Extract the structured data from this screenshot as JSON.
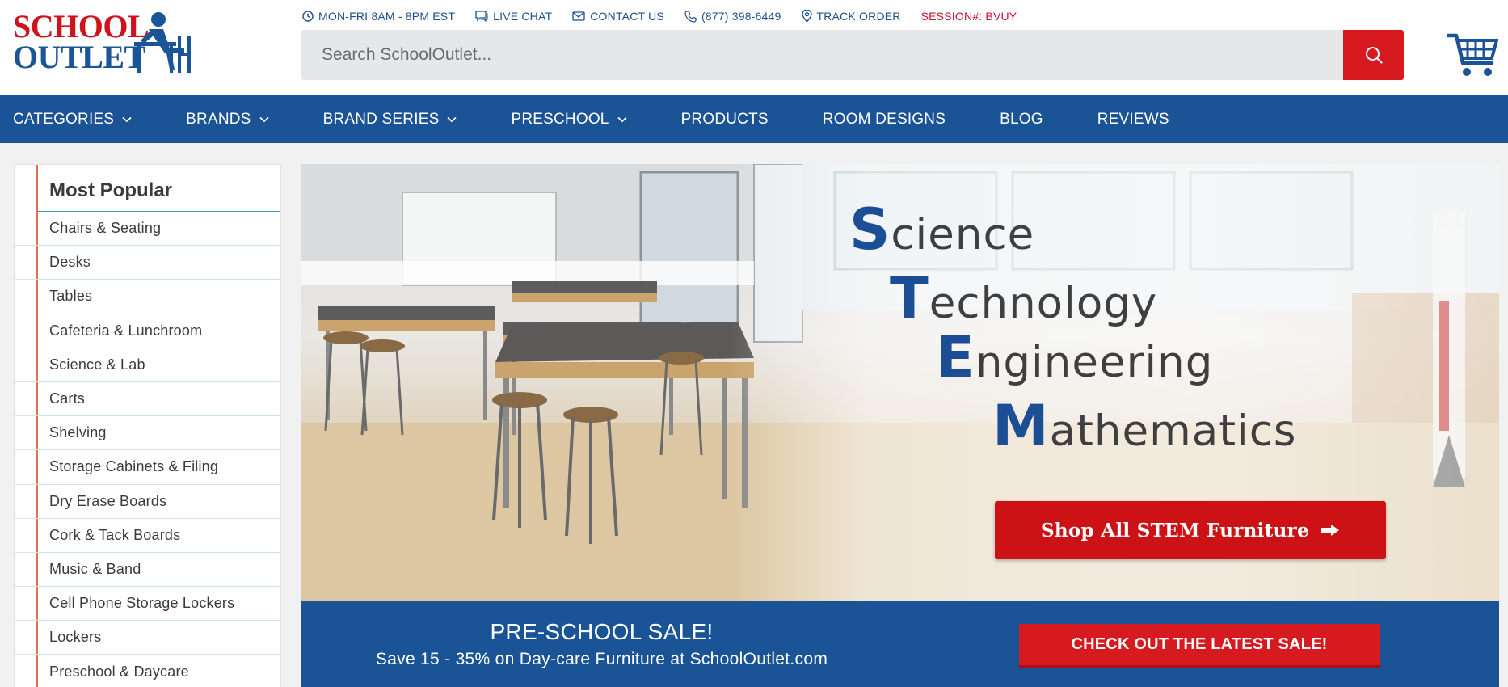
{
  "logo": {
    "line1": "SCHOOL",
    "line2": "OUTLET"
  },
  "topbar": {
    "hours": "MON-FRI 8AM - 8PM EST",
    "live_chat": "LIVE CHAT",
    "contact_us": "CONTACT US",
    "phone": "(877) 398-6449",
    "track_order": "TRACK ORDER",
    "session": "SESSION#: BVUY"
  },
  "search": {
    "placeholder": "Search SchoolOutlet..."
  },
  "nav": {
    "items": [
      {
        "label": "CATEGORIES"
      },
      {
        "label": "BRANDS"
      },
      {
        "label": "BRAND SERIES"
      },
      {
        "label": "PRESCHOOL"
      },
      {
        "label": "PRODUCTS"
      },
      {
        "label": "ROOM DESIGNS"
      },
      {
        "label": "BLOG"
      },
      {
        "label": "REVIEWS"
      }
    ]
  },
  "sidebar": {
    "title": "Most Popular",
    "items": [
      "Chairs & Seating",
      "Desks",
      "Tables",
      "Cafeteria & Lunchroom",
      "Science & Lab",
      "Carts",
      "Shelving",
      "Storage Cabinets & Filing",
      "Dry Erase Boards",
      "Cork & Tack Boards",
      "Music & Band",
      "Cell Phone Storage Lockers",
      "Lockers",
      "Preschool & Daycare"
    ]
  },
  "hero": {
    "s_cap": "S",
    "s_rest": "cience",
    "t_cap": "T",
    "t_rest": "echnology",
    "e_cap": "E",
    "e_rest": "ngineering",
    "m_cap": "M",
    "m_rest": "athematics",
    "cta": "Shop All STEM Furniture"
  },
  "sale": {
    "title": "PRE-SCHOOL SALE!",
    "subtitle": "Save 15 - 35% on Day-care Furniture at SchoolOutlet.com",
    "button": "CHECK OUT THE LATEST SALE!"
  },
  "colors": {
    "brand_blue": "#1b5496",
    "brand_red": "#d71920"
  }
}
